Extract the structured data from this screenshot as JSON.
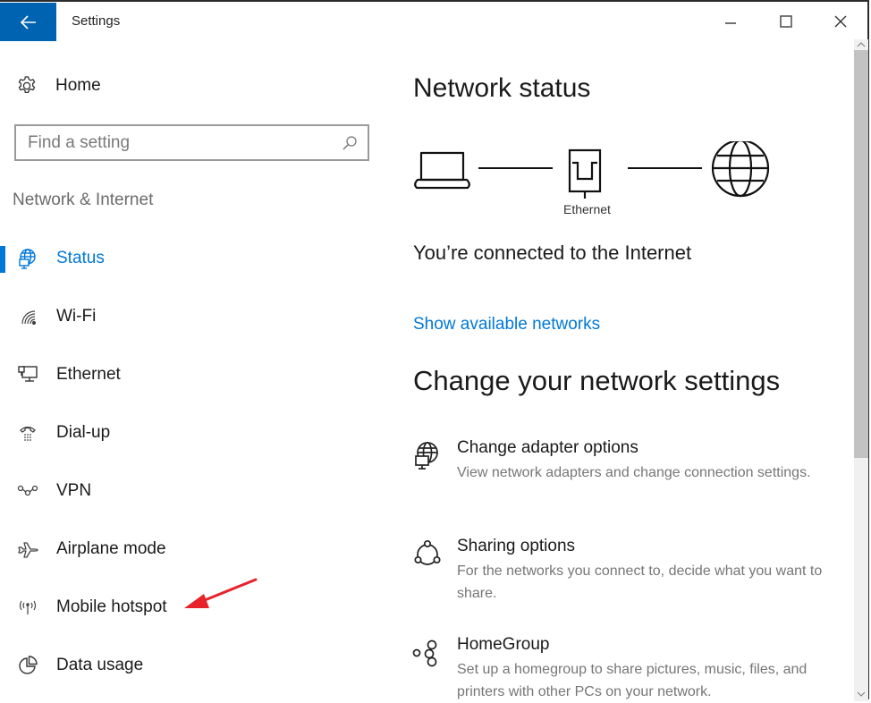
{
  "window": {
    "title": "Settings",
    "controls": {
      "minimize": "minimize",
      "maximize": "maximize",
      "close": "close"
    },
    "accent_color": "#0063b1"
  },
  "sidebar": {
    "home_label": "Home",
    "search_placeholder": "Find a setting",
    "section_label": "Network & Internet",
    "items": [
      {
        "label": "Status",
        "icon": "globe-monitor-icon",
        "active": true
      },
      {
        "label": "Wi-Fi",
        "icon": "wifi-icon",
        "active": false
      },
      {
        "label": "Ethernet",
        "icon": "ethernet-icon",
        "active": false
      },
      {
        "label": "Dial-up",
        "icon": "dial-up-phone-icon",
        "active": false
      },
      {
        "label": "VPN",
        "icon": "vpn-icon",
        "active": false
      },
      {
        "label": "Airplane mode",
        "icon": "airplane-icon",
        "active": false
      },
      {
        "label": "Mobile hotspot",
        "icon": "hotspot-icon",
        "active": false
      },
      {
        "label": "Data usage",
        "icon": "pie-chart-icon",
        "active": false
      }
    ],
    "active_color": "#0078d7"
  },
  "main": {
    "title": "Network status",
    "diagram": {
      "connection_label": "Ethernet"
    },
    "status_text": "You’re connected to the Internet",
    "show_networks_link": "Show available networks",
    "change_heading": "Change your network settings",
    "options": [
      {
        "title": "Change adapter options",
        "description": "View network adapters and change connection settings.",
        "icon": "adapter-globe-icon"
      },
      {
        "title": "Sharing options",
        "description": "For the networks you connect to, decide what you want to share.",
        "icon": "sharing-icon"
      },
      {
        "title": "HomeGroup",
        "description": "Set up a homegroup to share pictures, music, files, and printers with other PCs on your network.",
        "icon": "homegroup-icon"
      }
    ],
    "link_color": "#0078d7"
  },
  "annotation": {
    "arrow_color": "#e8222a",
    "points_to": "Mobile hotspot"
  }
}
